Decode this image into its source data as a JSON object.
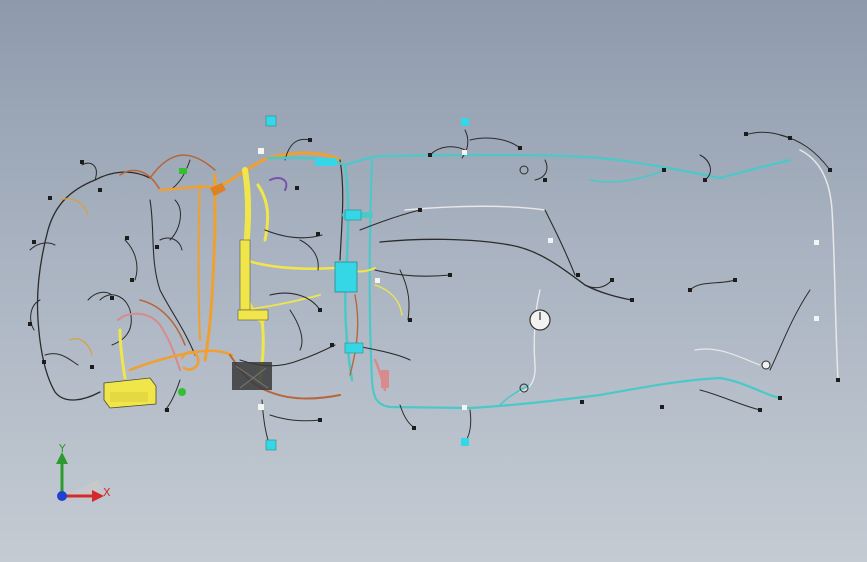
{
  "viewport": {
    "name": "wiring-harness-3d-view",
    "background_top": "#8e9aac",
    "background_bottom": "#c4cbd3"
  },
  "harness_colors": {
    "main_trunk": "#f0e64a",
    "engine_bay": "#f0a030",
    "body_trunk": "#4cc8c8",
    "connector": "#35d6e6",
    "black_wire": "#1c1c1c",
    "brown_wire": "#b8653a",
    "pink_wire": "#d98a8a",
    "white_wire": "#e8e8e8"
  },
  "components": {
    "battery_box": {
      "color": "#f0e64a",
      "icon": "battery-icon"
    },
    "steering_sensor": {
      "icon": "gauge-icon"
    }
  },
  "coordinate_triad": {
    "y_label": "Y",
    "x_label": "X",
    "y_color": "#2d9a2d",
    "x_color": "#d42a2a",
    "origin_color": "#2040d0"
  }
}
